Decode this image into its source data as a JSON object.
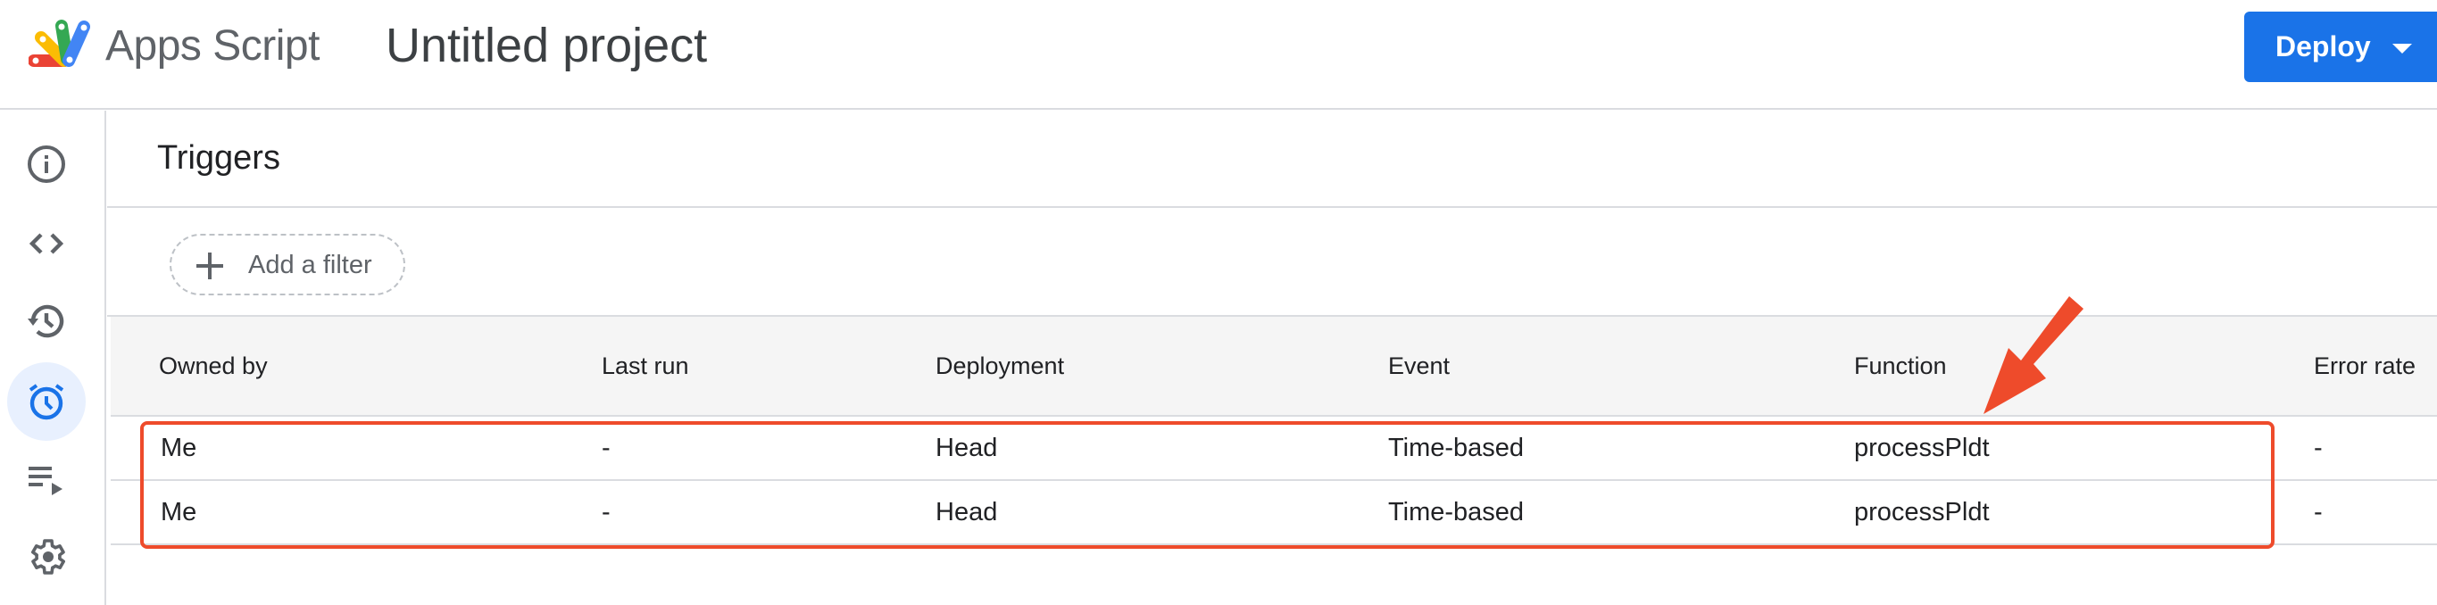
{
  "header": {
    "app_name": "Apps Script",
    "project_title": "Untitled project",
    "deploy_label": "Deploy"
  },
  "sidebar": {
    "items": [
      {
        "name": "overview",
        "icon": "info-icon",
        "active": false
      },
      {
        "name": "editor",
        "icon": "code-icon",
        "active": false
      },
      {
        "name": "project-history",
        "icon": "history-icon",
        "active": false
      },
      {
        "name": "triggers",
        "icon": "alarm-clock-icon",
        "active": true
      },
      {
        "name": "executions",
        "icon": "executions-icon",
        "active": false
      },
      {
        "name": "project-settings",
        "icon": "gear-icon",
        "active": false
      }
    ]
  },
  "main": {
    "title": "Triggers",
    "filter_label": "Add a filter",
    "table": {
      "columns": [
        "Owned by",
        "Last run",
        "Deployment",
        "Event",
        "Function",
        "Error rate"
      ],
      "rows": [
        [
          "Me",
          "-",
          "Head",
          "Time-based",
          "processPldt",
          "-"
        ],
        [
          "Me",
          "-",
          "Head",
          "Time-based",
          "processPldt",
          "-"
        ]
      ]
    }
  },
  "annotation": {
    "color": "#ee4b2b",
    "type": "highlight-box-with-arrow"
  },
  "colors": {
    "accent": "#1a73e8",
    "active_bg": "#e8f0fe",
    "annotation": "#ee4b2b"
  }
}
